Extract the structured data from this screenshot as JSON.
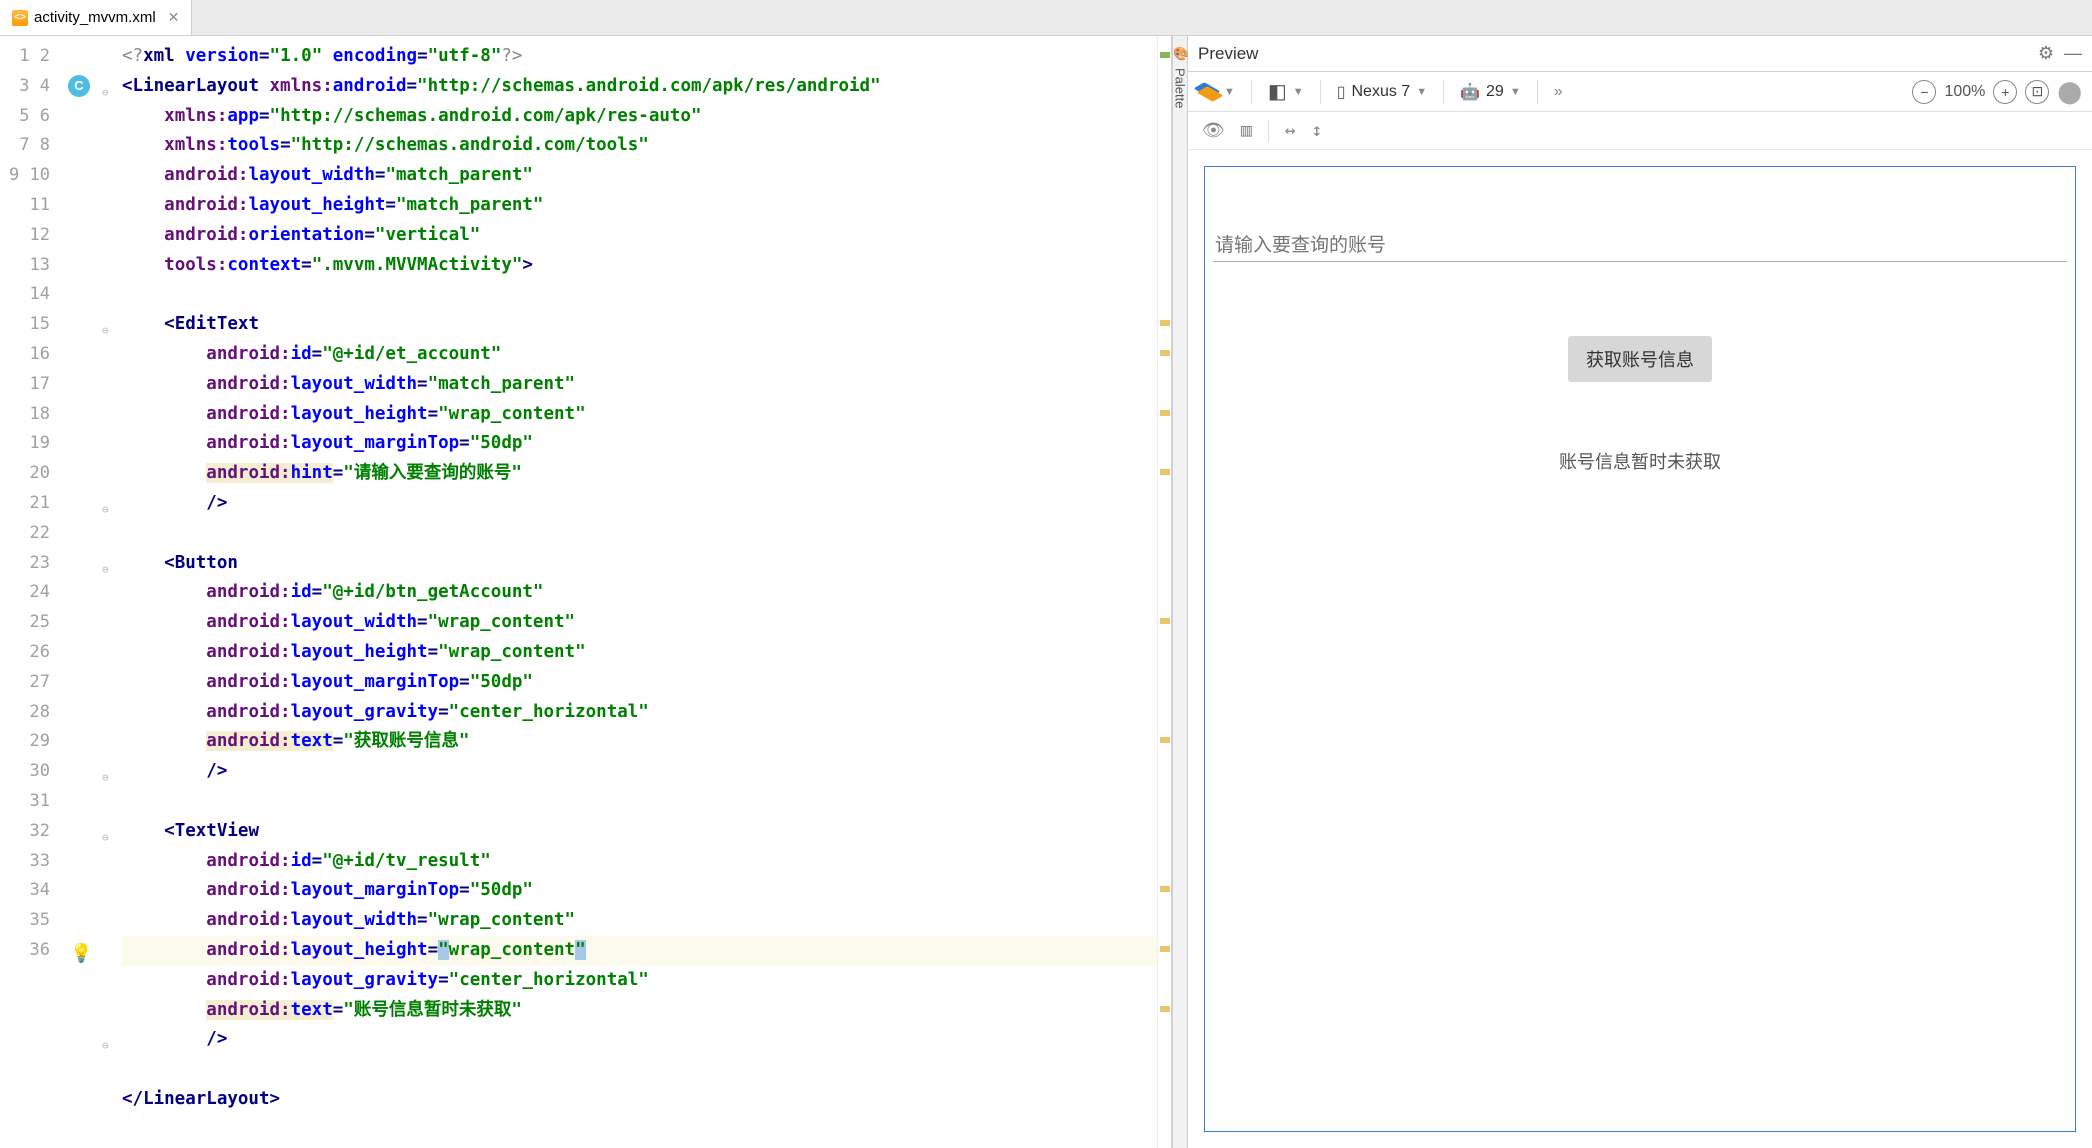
{
  "tab": {
    "filename": "activity_mvvm.xml"
  },
  "gutter": {
    "start": 1,
    "end": 36
  },
  "annotations": {
    "class_marker": "C",
    "bulb_line": 31
  },
  "code_lines": [
    [
      [
        "pi",
        "<?"
      ],
      [
        "tagn",
        "xml "
      ],
      [
        "attr",
        "version"
      ],
      [
        "tagp",
        "="
      ],
      [
        "str",
        "\"1.0\""
      ],
      [
        "attr",
        " encoding"
      ],
      [
        "tagp",
        "="
      ],
      [
        "str",
        "\"utf-8\""
      ],
      [
        "pi",
        "?>"
      ]
    ],
    [
      [
        "tagp",
        "<"
      ],
      [
        "tagn",
        "LinearLayout "
      ],
      [
        "ns",
        "xmlns:"
      ],
      [
        "attr",
        "android"
      ],
      [
        "tagp",
        "="
      ],
      [
        "str",
        "\"http://schemas.android.com/apk/res/android\""
      ]
    ],
    [
      [
        "pad",
        "    "
      ],
      [
        "ns",
        "xmlns:"
      ],
      [
        "attr",
        "app"
      ],
      [
        "tagp",
        "="
      ],
      [
        "str",
        "\"http://schemas.android.com/apk/res-auto\""
      ]
    ],
    [
      [
        "pad",
        "    "
      ],
      [
        "ns",
        "xmlns:"
      ],
      [
        "attr",
        "tools"
      ],
      [
        "tagp",
        "="
      ],
      [
        "str",
        "\"http://schemas.android.com/tools\""
      ]
    ],
    [
      [
        "pad",
        "    "
      ],
      [
        "ns",
        "android:"
      ],
      [
        "attr",
        "layout_width"
      ],
      [
        "tagp",
        "="
      ],
      [
        "str",
        "\"match_parent\""
      ]
    ],
    [
      [
        "pad",
        "    "
      ],
      [
        "ns",
        "android:"
      ],
      [
        "attr",
        "layout_height"
      ],
      [
        "tagp",
        "="
      ],
      [
        "str",
        "\"match_parent\""
      ]
    ],
    [
      [
        "pad",
        "    "
      ],
      [
        "ns",
        "android:"
      ],
      [
        "attr",
        "orientation"
      ],
      [
        "tagp",
        "="
      ],
      [
        "str",
        "\"vertical\""
      ]
    ],
    [
      [
        "pad",
        "    "
      ],
      [
        "ns",
        "tools:"
      ],
      [
        "attr",
        "context"
      ],
      [
        "tagp",
        "="
      ],
      [
        "str",
        "\".mvvm.MVVMActivity\""
      ],
      [
        "tagp",
        ">"
      ]
    ],
    [],
    [
      [
        "pad",
        "    "
      ],
      [
        "tagp",
        "<"
      ],
      [
        "tagn",
        "EditText"
      ]
    ],
    [
      [
        "pad",
        "        "
      ],
      [
        "ns",
        "android:"
      ],
      [
        "attr",
        "id"
      ],
      [
        "tagp",
        "="
      ],
      [
        "str",
        "\"@+id/et_account\""
      ]
    ],
    [
      [
        "pad",
        "        "
      ],
      [
        "ns",
        "android:"
      ],
      [
        "attr",
        "layout_width"
      ],
      [
        "tagp",
        "="
      ],
      [
        "str",
        "\"match_parent\""
      ]
    ],
    [
      [
        "pad",
        "        "
      ],
      [
        "ns",
        "android:"
      ],
      [
        "attr",
        "layout_height"
      ],
      [
        "tagp",
        "="
      ],
      [
        "str",
        "\"wrap_content\""
      ]
    ],
    [
      [
        "pad",
        "        "
      ],
      [
        "ns",
        "android:"
      ],
      [
        "attr",
        "layout_marginTop"
      ],
      [
        "tagp",
        "="
      ],
      [
        "str",
        "\"50dp\""
      ]
    ],
    [
      [
        "pad",
        "        "
      ],
      [
        "nshl",
        "android:"
      ],
      [
        "attrhl",
        "hint"
      ],
      [
        "tagp",
        "="
      ],
      [
        "str",
        "\"请输入要查询的账号\""
      ]
    ],
    [
      [
        "pad",
        "        "
      ],
      [
        "tagp",
        "/>"
      ]
    ],
    [],
    [
      [
        "pad",
        "    "
      ],
      [
        "tagp",
        "<"
      ],
      [
        "tagn",
        "Button"
      ]
    ],
    [
      [
        "pad",
        "        "
      ],
      [
        "ns",
        "android:"
      ],
      [
        "attr",
        "id"
      ],
      [
        "tagp",
        "="
      ],
      [
        "str",
        "\"@+id/btn_getAccount\""
      ]
    ],
    [
      [
        "pad",
        "        "
      ],
      [
        "ns",
        "android:"
      ],
      [
        "attr",
        "layout_width"
      ],
      [
        "tagp",
        "="
      ],
      [
        "str",
        "\"wrap_content\""
      ]
    ],
    [
      [
        "pad",
        "        "
      ],
      [
        "ns",
        "android:"
      ],
      [
        "attr",
        "layout_height"
      ],
      [
        "tagp",
        "="
      ],
      [
        "str",
        "\"wrap_content\""
      ]
    ],
    [
      [
        "pad",
        "        "
      ],
      [
        "ns",
        "android:"
      ],
      [
        "attr",
        "layout_marginTop"
      ],
      [
        "tagp",
        "="
      ],
      [
        "str",
        "\"50dp\""
      ]
    ],
    [
      [
        "pad",
        "        "
      ],
      [
        "ns",
        "android:"
      ],
      [
        "attr",
        "layout_gravity"
      ],
      [
        "tagp",
        "="
      ],
      [
        "str",
        "\"center_horizontal\""
      ]
    ],
    [
      [
        "pad",
        "        "
      ],
      [
        "nshl",
        "android:"
      ],
      [
        "attrhl",
        "text"
      ],
      [
        "tagp",
        "="
      ],
      [
        "str",
        "\"获取账号信息\""
      ]
    ],
    [
      [
        "pad",
        "        "
      ],
      [
        "tagp",
        "/>"
      ]
    ],
    [],
    [
      [
        "pad",
        "    "
      ],
      [
        "tagp",
        "<"
      ],
      [
        "tagn",
        "TextView"
      ]
    ],
    [
      [
        "pad",
        "        "
      ],
      [
        "ns",
        "android:"
      ],
      [
        "attr",
        "id"
      ],
      [
        "tagp",
        "="
      ],
      [
        "str",
        "\"@+id/tv_result\""
      ]
    ],
    [
      [
        "pad",
        "        "
      ],
      [
        "ns",
        "android:"
      ],
      [
        "attr",
        "layout_marginTop"
      ],
      [
        "tagp",
        "="
      ],
      [
        "str",
        "\"50dp\""
      ]
    ],
    [
      [
        "pad",
        "        "
      ],
      [
        "ns",
        "android:"
      ],
      [
        "attr",
        "layout_width"
      ],
      [
        "tagp",
        "="
      ],
      [
        "str",
        "\"wrap_content\""
      ]
    ],
    [
      [
        "pad",
        "        "
      ],
      [
        "ns",
        "android:"
      ],
      [
        "attr",
        "layout_height"
      ],
      [
        "tagp",
        "="
      ],
      [
        "strsel",
        "\"wrap_content\""
      ]
    ],
    [
      [
        "pad",
        "        "
      ],
      [
        "ns",
        "android:"
      ],
      [
        "attr",
        "layout_gravity"
      ],
      [
        "tagp",
        "="
      ],
      [
        "str",
        "\"center_horizontal\""
      ]
    ],
    [
      [
        "pad",
        "        "
      ],
      [
        "nshl",
        "android:"
      ],
      [
        "attrhl",
        "text"
      ],
      [
        "tagp",
        "="
      ],
      [
        "str",
        "\"账号信息暂时未获取\""
      ]
    ],
    [
      [
        "pad",
        "        "
      ],
      [
        "tagp",
        "/>"
      ]
    ],
    [],
    [
      [
        "tagp",
        "</"
      ],
      [
        "tagn",
        "LinearLayout"
      ],
      [
        "tagp",
        ">"
      ]
    ]
  ],
  "current_line": 31,
  "error_stripe": [
    {
      "pos": 1,
      "color": "green"
    },
    {
      "pos": 10,
      "color": "yellow"
    },
    {
      "pos": 11,
      "color": "yellow"
    },
    {
      "pos": 13,
      "color": "yellow"
    },
    {
      "pos": 15,
      "color": "yellow"
    },
    {
      "pos": 20,
      "color": "yellow"
    },
    {
      "pos": 24,
      "color": "yellow"
    },
    {
      "pos": 29,
      "color": "yellow"
    },
    {
      "pos": 31,
      "color": "yellow"
    },
    {
      "pos": 33,
      "color": "yellow"
    }
  ],
  "palette_label": "Palette",
  "preview": {
    "title": "Preview",
    "device": "Nexus 7",
    "api": "29",
    "zoom": "100%",
    "edit_hint": "请输入要查询的账号",
    "button_text": "获取账号信息",
    "textview_text": "账号信息暂时未获取"
  }
}
